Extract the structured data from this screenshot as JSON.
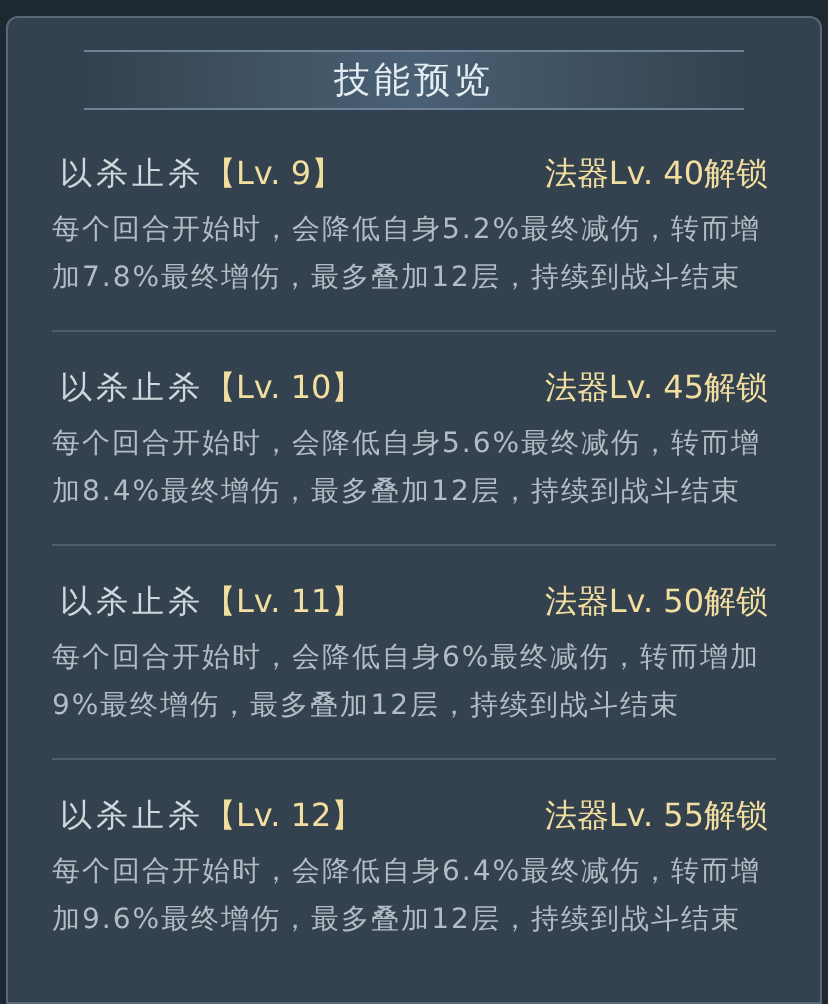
{
  "title": "技能预览",
  "skills": [
    {
      "name": "以杀止杀",
      "level": "【Lv. 9】",
      "unlock": "法器Lv. 40解锁",
      "description": "每个回合开始时，会降低自身5.2%最终减伤，转而增加7.8%最终增伤，最多叠加12层，持续到战斗结束"
    },
    {
      "name": "以杀止杀",
      "level": "【Lv. 10】",
      "unlock": "法器Lv. 45解锁",
      "description": "每个回合开始时，会降低自身5.6%最终减伤，转而增加8.4%最终增伤，最多叠加12层，持续到战斗结束"
    },
    {
      "name": "以杀止杀",
      "level": "【Lv. 11】",
      "unlock": "法器Lv. 50解锁",
      "description": "每个回合开始时，会降低自身6%最终减伤，转而增加9%最终增伤，最多叠加12层，持续到战斗结束"
    },
    {
      "name": "以杀止杀",
      "level": "【Lv. 12】",
      "unlock": "法器Lv. 55解锁",
      "description": "每个回合开始时，会降低自身6.4%最终减伤，转而增加9.6%最终增伤，最多叠加12层，持续到战斗结束"
    }
  ]
}
